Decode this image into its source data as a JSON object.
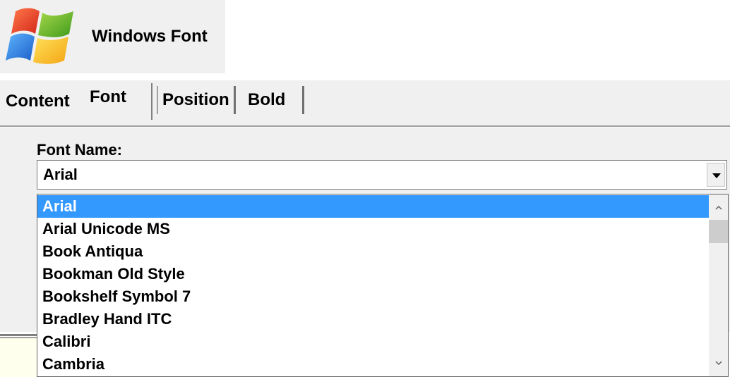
{
  "app": {
    "title": "Windows Font",
    "logo_icon": "windows-logo-icon"
  },
  "tabs": [
    {
      "label": "Content",
      "active": false
    },
    {
      "label": "Font",
      "active": true
    },
    {
      "label": "Position",
      "active": false
    },
    {
      "label": "Bold",
      "active": false
    }
  ],
  "font_panel": {
    "font_name_label": "Font Name:",
    "selected_value": "Arial",
    "dropdown_icon": "chevron-down-icon",
    "options": [
      "Arial",
      "Arial Unicode MS",
      "Book Antiqua",
      "Bookman Old Style",
      "Bookshelf Symbol 7",
      "Bradley Hand ITC",
      "Calibri",
      "Cambria"
    ],
    "highlighted_index": 0
  },
  "colors": {
    "selection": "#3399ff",
    "panel_bg": "#f0f0f0"
  }
}
